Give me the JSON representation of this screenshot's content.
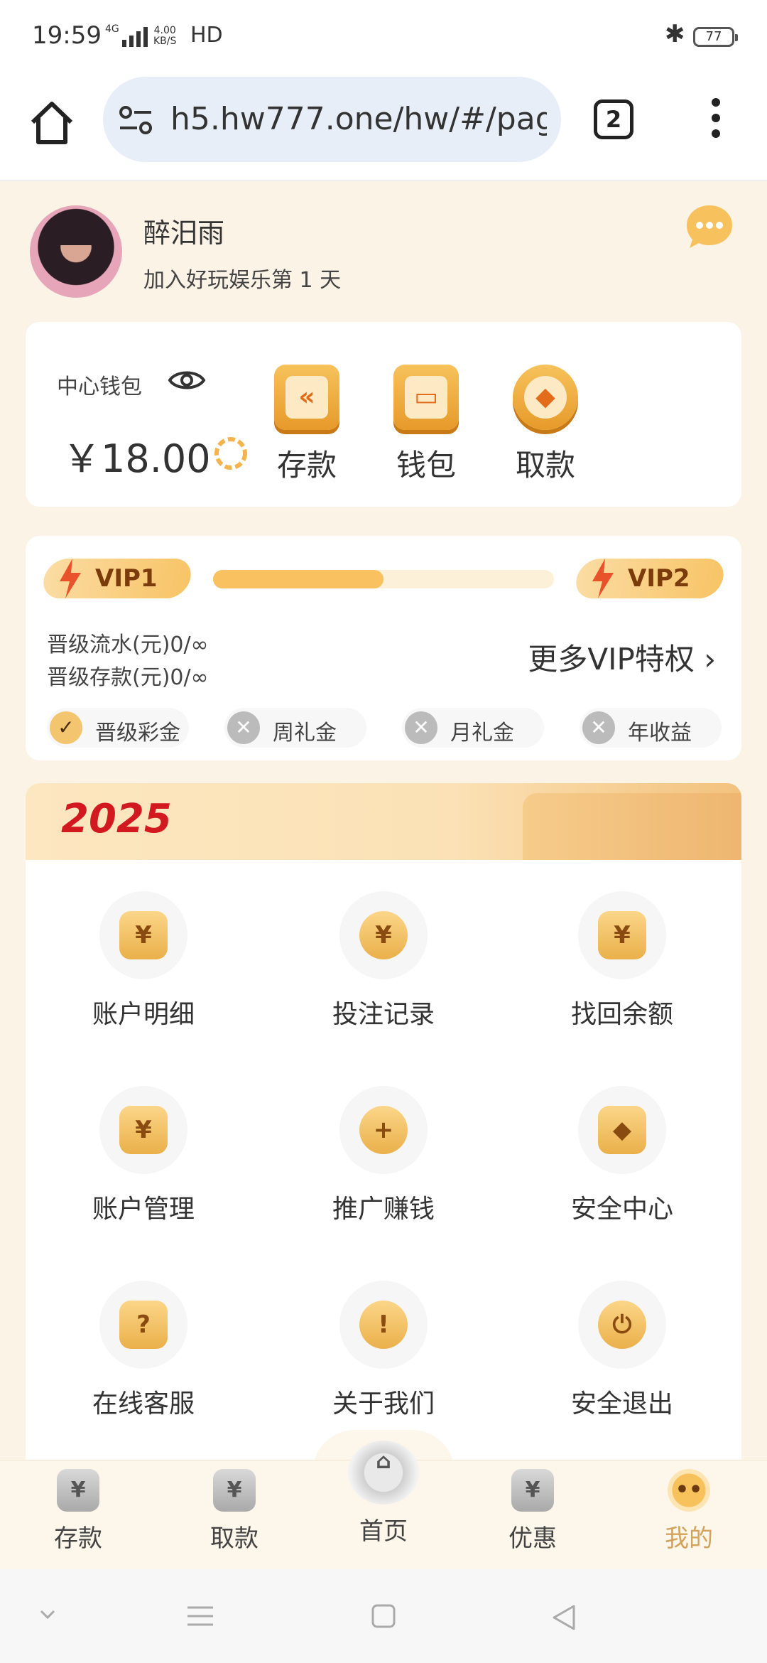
{
  "status_bar": {
    "time": "19:59",
    "network": "4G",
    "speed_value": "4.00",
    "speed_unit": "KB/S",
    "hd": "HD",
    "battery": "77"
  },
  "browser": {
    "url": "h5.hw777.one/hw/#/pag",
    "tab_count": "2"
  },
  "profile": {
    "username": "醉汨雨",
    "join_text": "加入好玩娱乐第 1 天"
  },
  "wallet": {
    "label": "中心钱包",
    "amount": "￥18.00",
    "actions": [
      {
        "label": "存款",
        "icon": "deposit-icon",
        "glyph": "«"
      },
      {
        "label": "钱包",
        "icon": "wallet-icon",
        "glyph": "▭"
      },
      {
        "label": "取款",
        "icon": "withdraw-icon",
        "glyph": "◆"
      }
    ]
  },
  "vip": {
    "current": "VIP1",
    "next": "VIP2",
    "progress": 0.5,
    "turnover_line": "晋级流水(元)0/∞",
    "deposit_line": "晋级存款(元)0/∞",
    "more_label": "更多VIP特权",
    "perks": [
      {
        "label": "晋级彩金",
        "status": "✓"
      },
      {
        "label": "周礼金",
        "status": "✕"
      },
      {
        "label": "月礼金",
        "status": "✕"
      },
      {
        "label": "年收益",
        "status": "✕"
      }
    ]
  },
  "banner": {
    "year": "2025"
  },
  "menu": [
    {
      "label": "账户明细",
      "glyph": "¥"
    },
    {
      "label": "投注记录",
      "glyph": "¥"
    },
    {
      "label": "找回余额",
      "glyph": "¥"
    },
    {
      "label": "账户管理",
      "glyph": "¥"
    },
    {
      "label": "推广赚钱",
      "glyph": "+"
    },
    {
      "label": "安全中心",
      "glyph": "◆"
    },
    {
      "label": "在线客服",
      "glyph": "?"
    },
    {
      "label": "关于我们",
      "glyph": "!"
    },
    {
      "label": "安全退出",
      "glyph": "⏻"
    }
  ],
  "tabbar": [
    {
      "label": "存款",
      "glyph": "¥"
    },
    {
      "label": "取款",
      "glyph": "¥"
    },
    {
      "label": "首页",
      "glyph": "⌂"
    },
    {
      "label": "优惠",
      "glyph": "¥"
    },
    {
      "label": "我的",
      "glyph": "••"
    }
  ],
  "colors": {
    "accent": "#f9c15f",
    "active_tab": "#d5a25a",
    "background": "#fbf3e6"
  }
}
